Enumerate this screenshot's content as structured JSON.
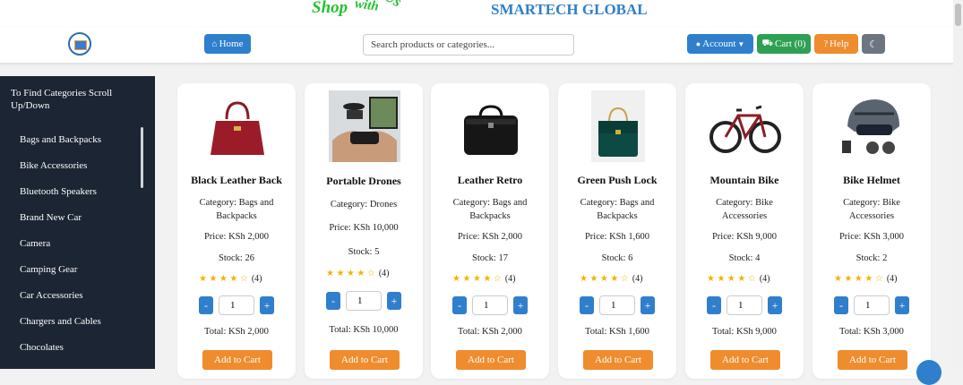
{
  "header": {
    "shop_word": "Shop",
    "shop_with": "with",
    "shop_us": "Us",
    "brand_title": "SMARTECH GLOBAL"
  },
  "nav": {
    "home_label": "Home",
    "search_placeholder": "Search products or categories...",
    "account_label": "Account",
    "cart_label": "Cart (0)",
    "help_label": "Help"
  },
  "sidebar": {
    "title": "To Find Categories Scroll Up/Down",
    "items": [
      {
        "label": "Bags and Backpacks"
      },
      {
        "label": "Bike Accessories"
      },
      {
        "label": "Bluetooth Speakers"
      },
      {
        "label": "Brand New Car"
      },
      {
        "label": "Camera"
      },
      {
        "label": "Camping Gear"
      },
      {
        "label": "Car Accessories"
      },
      {
        "label": "Chargers and Cables"
      },
      {
        "label": "Chocolates"
      }
    ]
  },
  "products": [
    {
      "name": "Black Leather Back",
      "category": "Category: Bags and Backpacks",
      "price": "Price: KSh 2,000",
      "stock": "Stock: 26",
      "rating": 4,
      "rating_count": "(4)",
      "qty": "1",
      "total": "Total: KSh 2,000",
      "cta": "Add to Cart",
      "image_icon": "handbag-icon"
    },
    {
      "name": "Portable Drones",
      "category": "Category: Drones",
      "price": "Price: KSh 10,000",
      "stock": "Stock: 5",
      "rating": 4,
      "rating_count": "(4)",
      "qty": "1",
      "total": "Total: KSh 10,000",
      "cta": "Add to Cart",
      "image_icon": "drone-icon"
    },
    {
      "name": "Leather Retro",
      "category": "Category: Bags and Backpacks",
      "price": "Price: KSh 2,000",
      "stock": "Stock: 17",
      "rating": 4,
      "rating_count": "(4)",
      "qty": "1",
      "total": "Total: KSh 2,000",
      "cta": "Add to Cart",
      "image_icon": "briefcase-icon"
    },
    {
      "name": "Green Push Lock",
      "category": "Category: Bags and Backpacks",
      "price": "Price: KSh 1,600",
      "stock": "Stock: 6",
      "rating": 4,
      "rating_count": "(4)",
      "qty": "1",
      "total": "Total: KSh 1,600",
      "cta": "Add to Cart",
      "image_icon": "green-bag-icon"
    },
    {
      "name": "Mountain Bike",
      "category": "Category: Bike Accessories",
      "price": "Price: KSh 9,000",
      "stock": "Stock: 4",
      "rating": 4,
      "rating_count": "(4)",
      "qty": "1",
      "total": "Total: KSh 9,000",
      "cta": "Add to Cart",
      "image_icon": "bicycle-icon"
    },
    {
      "name": "Bike Helmet",
      "category": "Category: Bike Accessories",
      "price": "Price: KSh 3,000",
      "stock": "Stock: 2",
      "rating": 4,
      "rating_count": "(4)",
      "qty": "1",
      "total": "Total: KSh 3,000",
      "cta": "Add to Cart",
      "image_icon": "helmet-icon"
    }
  ],
  "colors": {
    "primary": "#2f7fcc",
    "success": "#2ea053",
    "warning": "#ef8c2e",
    "sidebar_bg": "#1b2533",
    "shop_green": "#22c232",
    "brand_blue": "#2f80c8"
  }
}
